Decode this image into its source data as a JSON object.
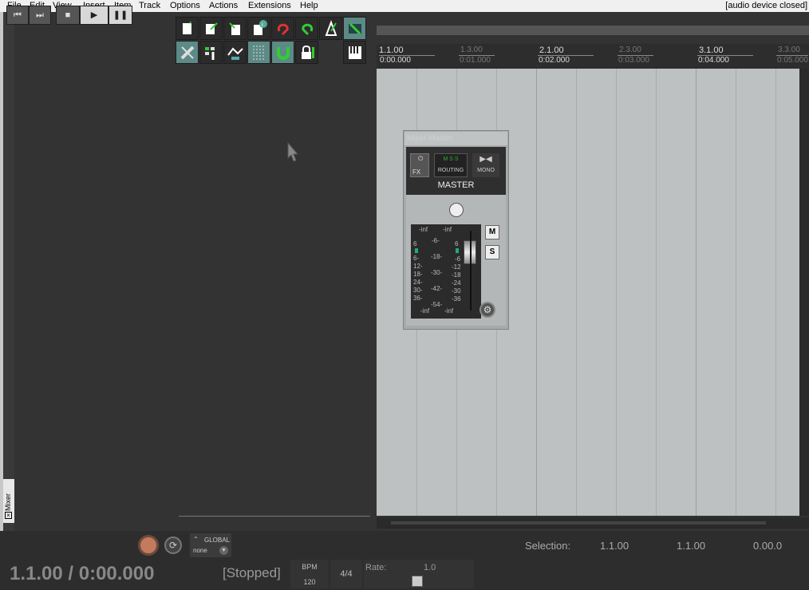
{
  "menu": {
    "items": [
      "File",
      "Edit",
      "View",
      "Insert",
      "Item",
      "Track",
      "Options",
      "Actions",
      "Extensions",
      "Help"
    ],
    "status": "[audio device closed]"
  },
  "ruler": {
    "markers": [
      {
        "bar": "1.1.00",
        "time": "0:00.000",
        "minor": false
      },
      {
        "bar": "1.3.00",
        "time": "0:01.000",
        "minor": true
      },
      {
        "bar": "2.1.00",
        "time": "0:02.000",
        "minor": false
      },
      {
        "bar": "2.3.00",
        "time": "0:03.000",
        "minor": true
      },
      {
        "bar": "3.1.00",
        "time": "0:04.000",
        "minor": false
      },
      {
        "bar": "3.3.00",
        "time": "0:05.000",
        "minor": true
      }
    ]
  },
  "mixer_window": {
    "title": "Mixer Master",
    "fx_label": "FX",
    "routing_label": "ROUTING",
    "routing_mss": "M  S  S",
    "mono_label": "MONO",
    "track_name": "MASTER",
    "peak_left": "-inf",
    "peak_right": "-inf",
    "mute_label": "M",
    "solo_label": "S",
    "scale_left": [
      "6",
      "6-",
      "12-",
      "18-",
      "24-",
      "30-",
      "36-"
    ],
    "scale_mid": [
      "-6-",
      "-18-",
      "-30-",
      "-42-",
      "-54-"
    ],
    "scale_right": [
      "6",
      "-6",
      "-12",
      "-18",
      "-24",
      "-30",
      "-36"
    ],
    "bottom_left": "-inf",
    "bottom_right": "-inf"
  },
  "dock": {
    "mixer_tab_label": "Mixer"
  },
  "transport": {
    "global_label": "GLOBAL",
    "global_value": "none",
    "selection_label": "Selection:",
    "selection_start": "1.1.00",
    "selection_end": "1.1.00",
    "selection_length": "0.00.0",
    "time_position": "1.1.00 / 0:00.000",
    "state": "[Stopped]",
    "bpm_label": "BPM",
    "bpm_value": "120",
    "time_signature": "4/4",
    "rate_label": "Rate:",
    "rate_value": "1.0"
  },
  "colors": {
    "arrange_bg": "#bdc1c2",
    "toolbar_active": "#5d8a86",
    "dark_bg": "#333333"
  }
}
